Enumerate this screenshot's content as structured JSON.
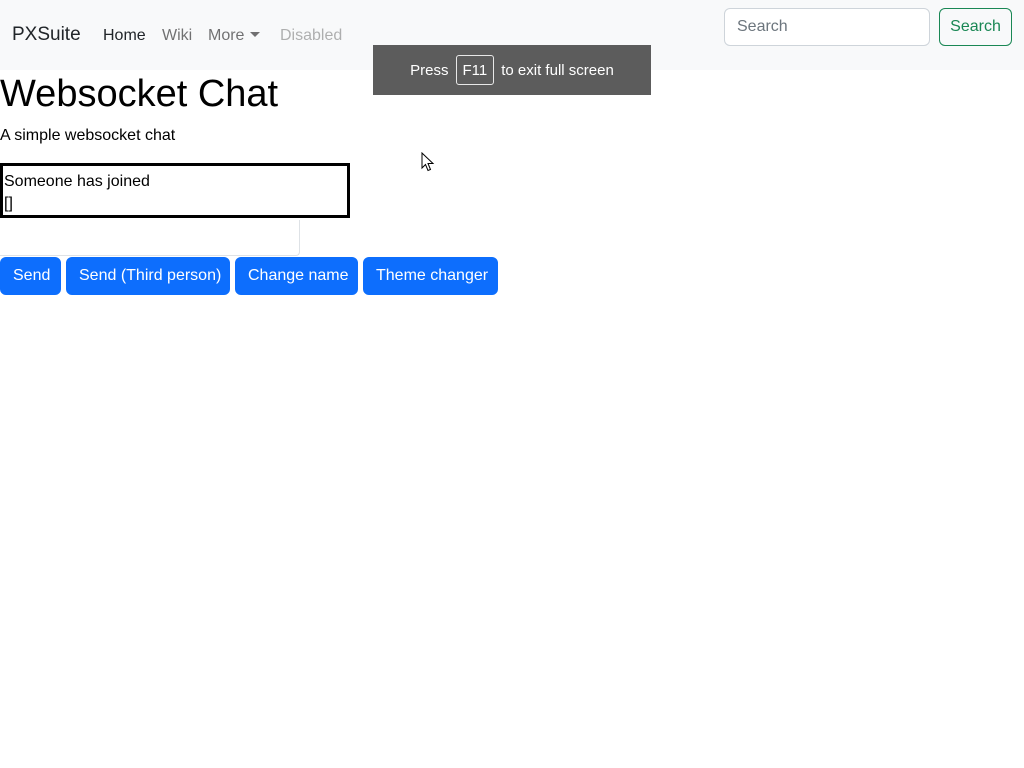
{
  "navbar": {
    "brand": "PXSuite",
    "links": [
      {
        "label": "Home"
      },
      {
        "label": "Wiki"
      },
      {
        "label": "More"
      },
      {
        "label": "Disabled"
      }
    ],
    "search": {
      "placeholder": "Search",
      "value": "",
      "button_label": "Search"
    }
  },
  "fullscreen_notice": {
    "before": "Press",
    "key": "F11",
    "after": "to exit full screen"
  },
  "page": {
    "title": "Websocket Chat",
    "subtitle": "A simple websocket chat"
  },
  "chat": {
    "messages": [
      "Someone has joined",
      "[]"
    ],
    "input_value": ""
  },
  "actions": {
    "send_label": "Send",
    "send_third_person_label": "Send (Third person)",
    "change_name_label": "Change name",
    "theme_changer_label": "Theme changer"
  },
  "colors": {
    "navbar_bg": "#f8f9fa",
    "primary": "#0d6efd",
    "success": "#198754"
  },
  "icons": {
    "cursor": "mouse-pointer-icon"
  }
}
